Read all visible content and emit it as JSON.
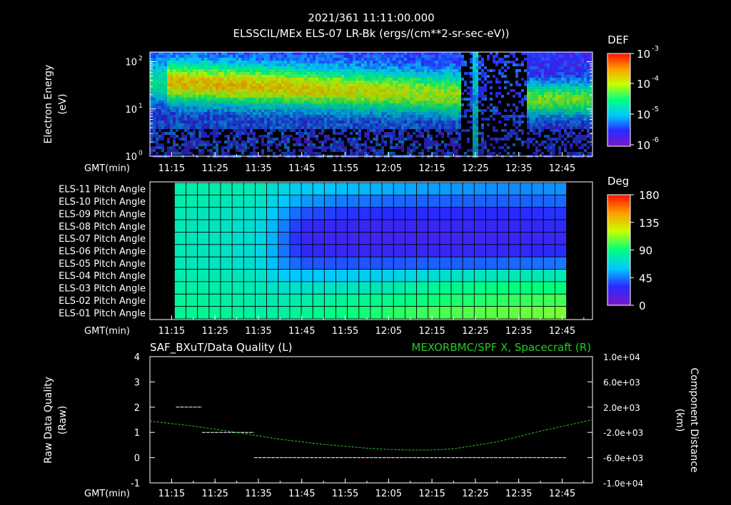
{
  "header": {
    "date": "2021/361 11:11:00.000",
    "title": "ELSSCIL/MEx ELS-07 LR-Bk  (ergs/(cm**2-sr-sec-eV))"
  },
  "time_axis": {
    "label": "GMT(min)",
    "ticks": [
      "11:15",
      "11:25",
      "11:35",
      "11:45",
      "11:55",
      "12:05",
      "12:15",
      "12:25",
      "12:35",
      "12:45"
    ]
  },
  "colors": {
    "background": "#000000",
    "axis": "#ffffff",
    "grid": "#000000",
    "trace": "#22cc22"
  },
  "chart_data": [
    {
      "type": "heatmap",
      "ylabel": "Electron Energy\n(eV)",
      "yscale": "log",
      "ylim": [
        1,
        160
      ],
      "yticks": [
        {
          "v": 1,
          "base": "10",
          "exp": "0"
        },
        {
          "v": 10,
          "base": "10",
          "exp": "1"
        },
        {
          "v": 100,
          "base": "10",
          "exp": "2"
        }
      ],
      "colorbar": {
        "title": "DEF",
        "ticks": [
          {
            "base": "10",
            "exp": "-3"
          },
          {
            "base": "10",
            "exp": "-4"
          },
          {
            "base": "10",
            "exp": "-5"
          },
          {
            "base": "10",
            "exp": "-6"
          }
        ]
      },
      "colormap": [
        "#7a18c8",
        "#2a2aff",
        "#00c8ff",
        "#00ff80",
        "#c8ff00",
        "#ffa000",
        "#ff1000"
      ],
      "xlim": [
        "11:10",
        "12:52"
      ],
      "data_gap": [
        "12:22",
        "12:37"
      ]
    },
    {
      "type": "heatmap",
      "rows": [
        "ELS-11 Pitch Angle",
        "ELS-10 Pitch Angle",
        "ELS-09 Pitch Angle",
        "ELS-08 Pitch Angle",
        "ELS-07 Pitch Angle",
        "ELS-06 Pitch Angle",
        "ELS-05 Pitch Angle",
        "ELS-04 Pitch Angle",
        "ELS-03 Pitch Angle",
        "ELS-02 Pitch Angle",
        "ELS-01 Pitch Angle"
      ],
      "colorbar": {
        "title": "Deg",
        "ticks": [
          "180",
          "135",
          "90",
          "45",
          "0"
        ],
        "range": [
          0,
          180
        ]
      },
      "colormap": [
        "#7a18c8",
        "#2a2aff",
        "#00c8ff",
        "#00ff80",
        "#c8ff00",
        "#ffa000",
        "#ff1000"
      ],
      "x_start": "11:15",
      "x_end": "12:46",
      "columns": 34,
      "sample_times": [
        "11:15",
        "11:25",
        "11:35",
        "11:40",
        "11:45",
        "11:55",
        "12:05",
        "12:15",
        "12:25",
        "12:35",
        "12:46"
      ],
      "values": [
        [
          80,
          80,
          78,
          68,
          62,
          58,
          55,
          52,
          50,
          48,
          50
        ],
        [
          80,
          78,
          75,
          62,
          52,
          45,
          42,
          40,
          40,
          40,
          42
        ],
        [
          78,
          75,
          72,
          55,
          38,
          32,
          30,
          30,
          30,
          30,
          32
        ],
        [
          78,
          75,
          70,
          50,
          28,
          25,
          24,
          24,
          25,
          26,
          28
        ],
        [
          78,
          75,
          70,
          48,
          25,
          22,
          22,
          22,
          23,
          24,
          25
        ],
        [
          78,
          75,
          70,
          48,
          28,
          25,
          25,
          25,
          26,
          28,
          30
        ],
        [
          78,
          75,
          70,
          52,
          38,
          38,
          38,
          40,
          40,
          42,
          45
        ],
        [
          80,
          78,
          75,
          62,
          60,
          62,
          65,
          70,
          75,
          78,
          78
        ],
        [
          82,
          80,
          78,
          72,
          72,
          75,
          78,
          85,
          88,
          90,
          90
        ],
        [
          85,
          82,
          80,
          78,
          80,
          85,
          88,
          92,
          95,
          98,
          100
        ],
        [
          85,
          85,
          82,
          82,
          85,
          90,
          95,
          100,
          103,
          105,
          108
        ]
      ]
    },
    {
      "type": "line",
      "title_left": "SAF_BXuT/Data Quality (L)",
      "title_right": "MEXORBMC/SPF X, Spacecraft (R)",
      "ylabel_left": "Raw Data Quality\n(Raw)",
      "ylabel_right": "Component Distance\n(km)",
      "ylim_left": [
        -1,
        4
      ],
      "yticks_left": [
        "-1",
        "0",
        "1",
        "2",
        "3",
        "4"
      ],
      "ylim_right": [
        -10000,
        10000
      ],
      "yticks_right": [
        "1.0e+04",
        "6.0e+03",
        "2.0e+03",
        "-2.0e+03",
        "-6.0e+03",
        "-1.0e+04"
      ],
      "series": [
        {
          "name": "SAF_BXuT/Data Quality (L)",
          "axis": "left",
          "segments": [
            {
              "x": [
                "11:16",
                "11:22"
              ],
              "y": 2
            },
            {
              "x": [
                "11:22",
                "11:34"
              ],
              "y": 1
            },
            {
              "x": [
                "11:34",
                "12:46"
              ],
              "y": 0
            }
          ]
        },
        {
          "name": "MEXORBMC/SPF X, Spacecraft (R)",
          "axis": "right",
          "x": [
            "11:10",
            "11:20",
            "11:30",
            "11:40",
            "11:50",
            "12:00",
            "12:05",
            "12:10",
            "12:15",
            "12:20",
            "12:30",
            "12:40",
            "12:52"
          ],
          "y": [
            -200,
            -1000,
            -2000,
            -3100,
            -3900,
            -4500,
            -4700,
            -4800,
            -4800,
            -4600,
            -3500,
            -1800,
            0
          ]
        }
      ]
    }
  ]
}
